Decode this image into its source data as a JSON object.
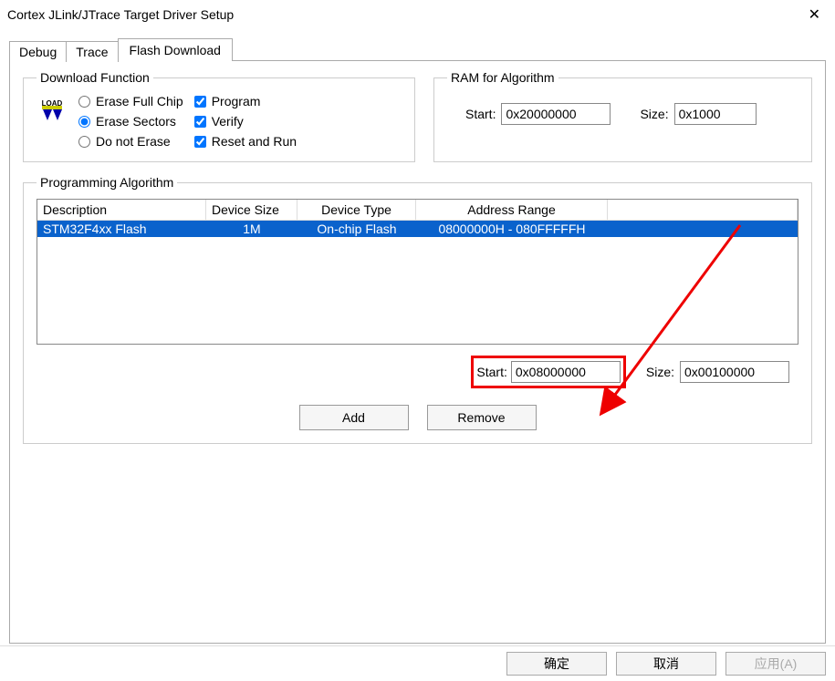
{
  "window": {
    "title": "Cortex JLink/JTrace Target Driver Setup"
  },
  "tabs": {
    "debug": "Debug",
    "trace": "Trace",
    "flash": "Flash Download"
  },
  "download": {
    "legend": "Download Function",
    "icon_label": "LOAD",
    "erase_full": "Erase Full Chip",
    "erase_sectors": "Erase Sectors",
    "do_not_erase": "Do not Erase",
    "program": "Program",
    "verify": "Verify",
    "reset_run": "Reset and Run"
  },
  "ram": {
    "legend": "RAM for Algorithm",
    "start_label": "Start:",
    "start_value": "0x20000000",
    "size_label": "Size:",
    "size_value": "0x1000"
  },
  "prog": {
    "legend": "Programming Algorithm",
    "headers": {
      "desc": "Description",
      "dsize": "Device Size",
      "dtype": "Device Type",
      "arange": "Address Range"
    },
    "row": {
      "desc": "STM32F4xx Flash",
      "dsize": "1M",
      "dtype": "On-chip Flash",
      "arange": "08000000H - 080FFFFFH"
    },
    "start_label": "Start:",
    "start_value": "0x08000000",
    "size_label": "Size:",
    "size_value": "0x00100000",
    "add": "Add",
    "remove": "Remove"
  },
  "buttons": {
    "ok": "确定",
    "cancel": "取消",
    "apply": "应用(A)"
  }
}
